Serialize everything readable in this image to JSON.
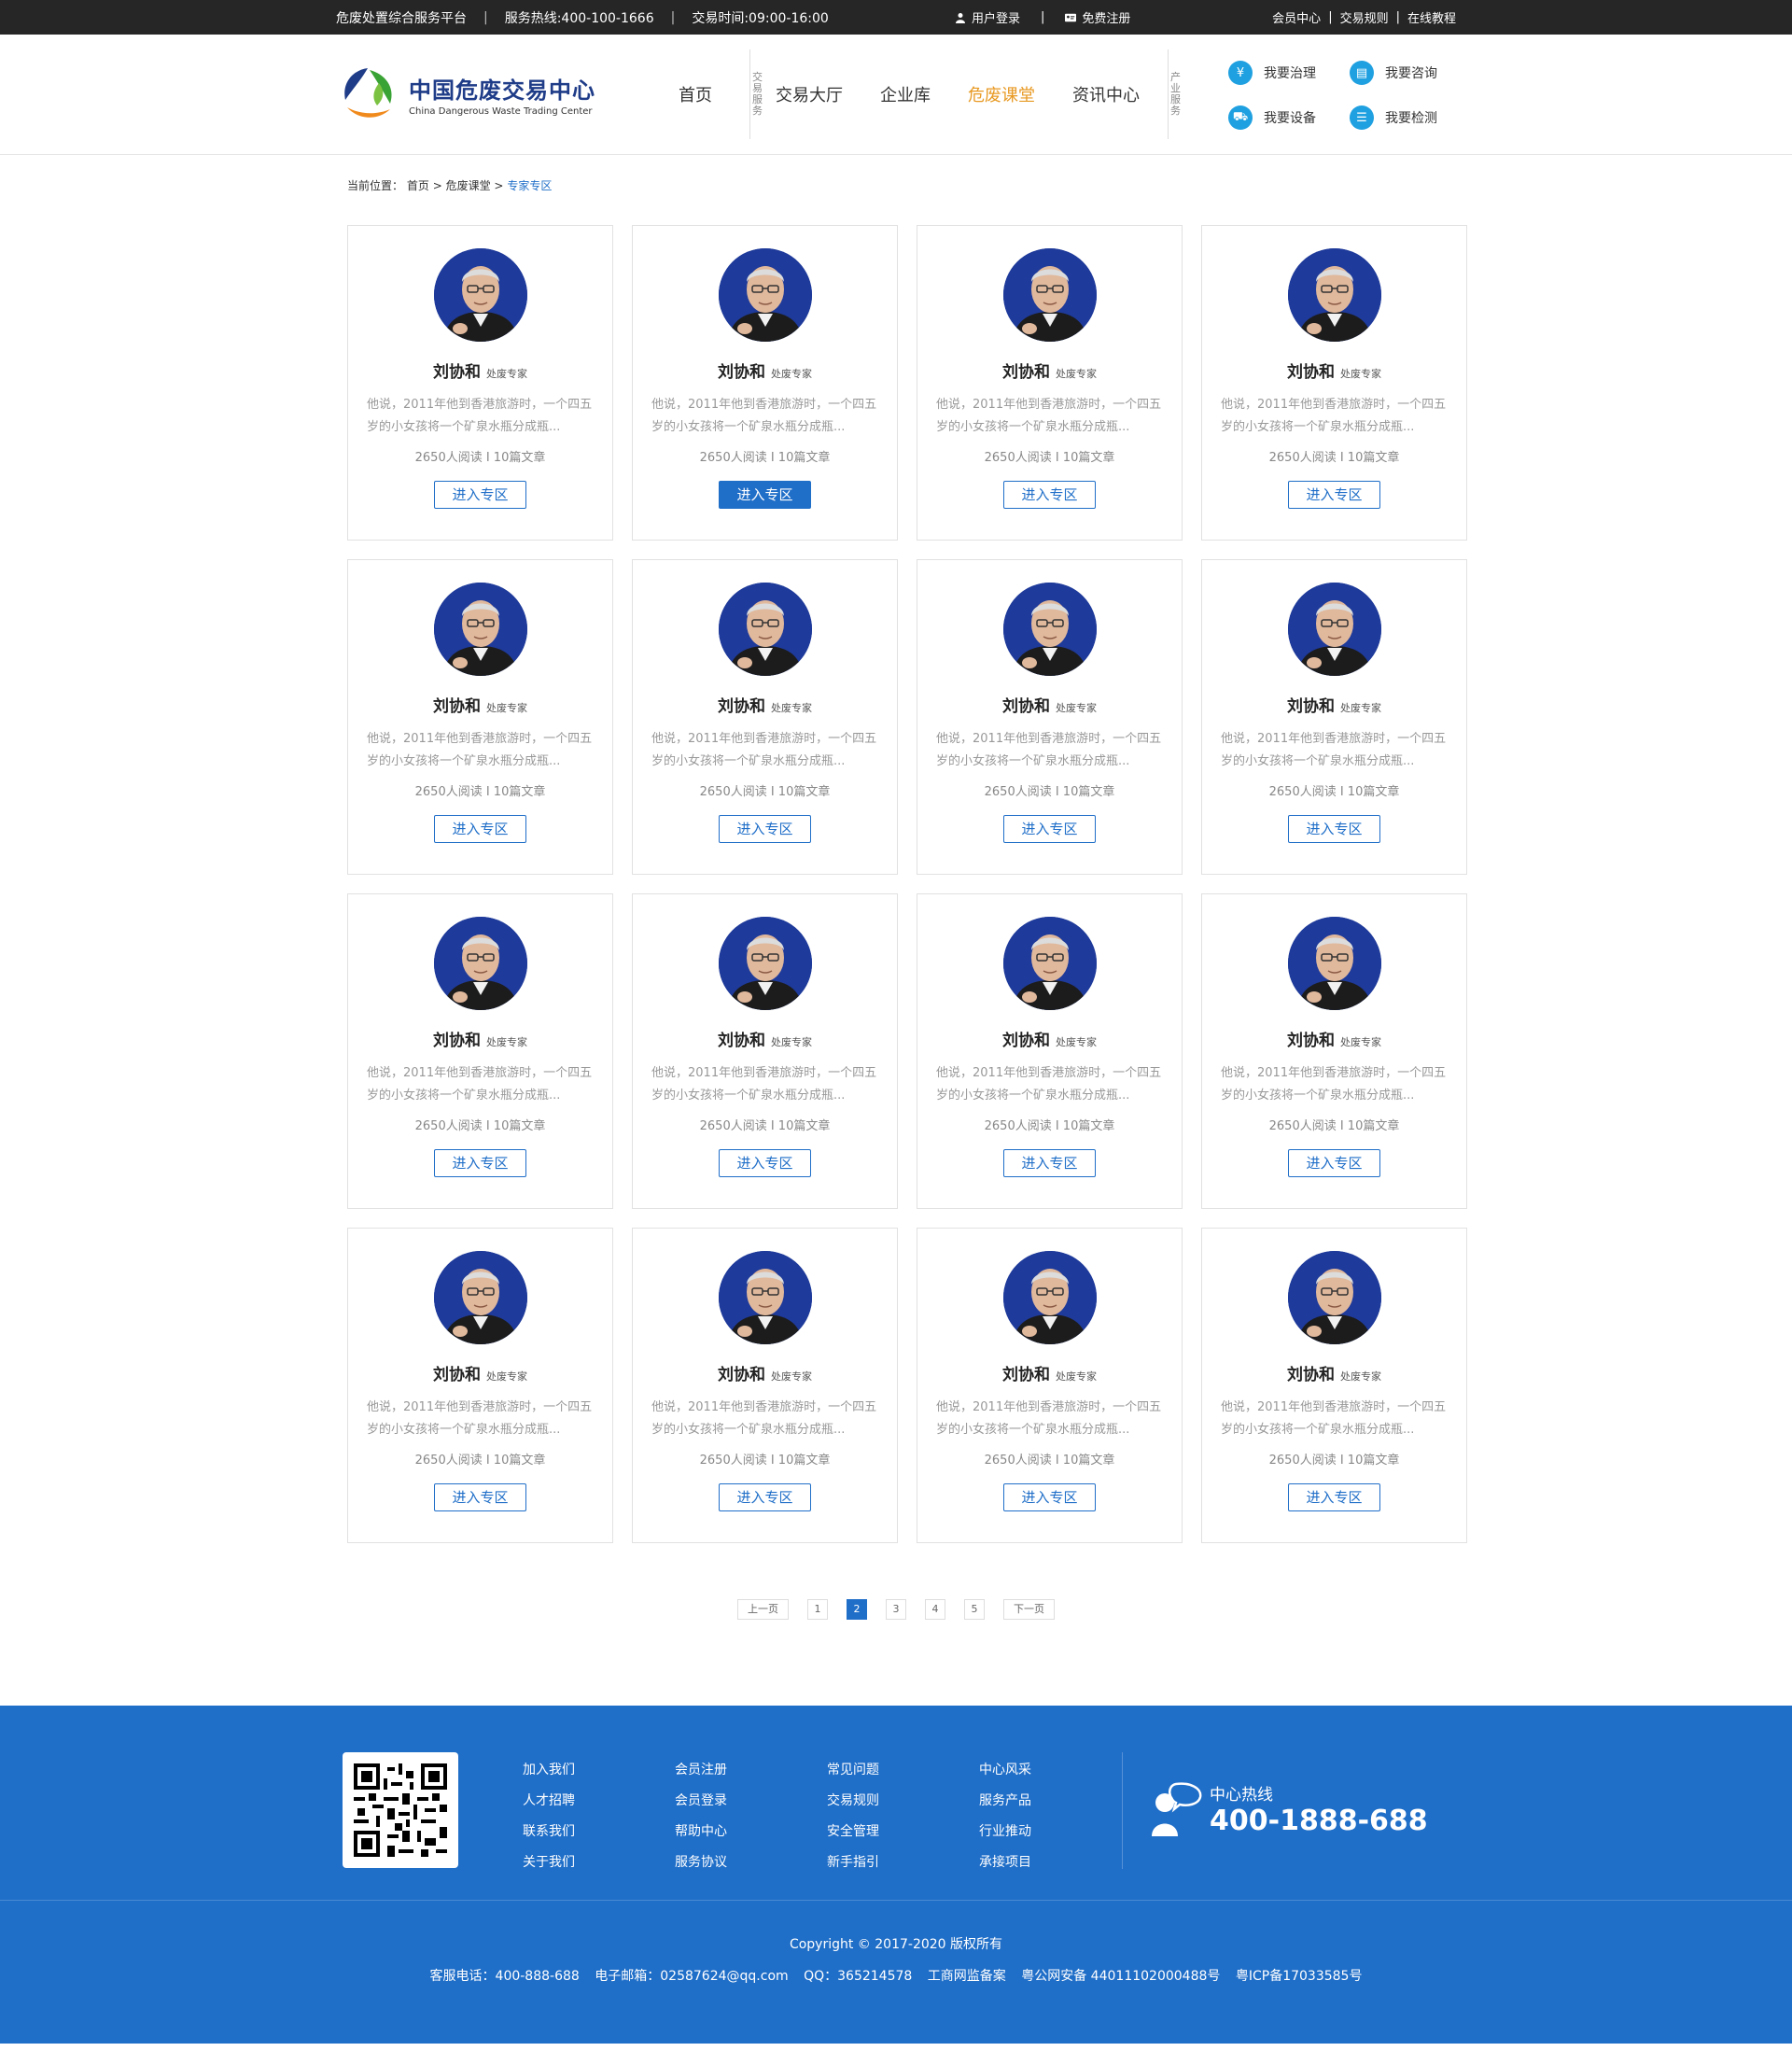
{
  "topbar": {
    "platform": "危废处置综合服务平台",
    "hotline": "服务热线:400-100-1666",
    "hours": "交易时间:09:00-16:00",
    "login": "用户登录",
    "register": "免费注册",
    "member_center": "会员中心",
    "trade_rules": "交易规则",
    "tutorial": "在线教程"
  },
  "logo": {
    "cn": "中国危废交易中心",
    "en": "China Dangerous Waste Trading Center"
  },
  "nav": {
    "items": [
      "首页",
      "交易大厅",
      "企业库",
      "危废课堂",
      "资讯中心"
    ],
    "active_index": 3,
    "vlabel_1": "交易服务",
    "vlabel_2": "产业服务"
  },
  "services": [
    {
      "label": "我要治理",
      "icon": "yen-icon"
    },
    {
      "label": "我要咨询",
      "icon": "chat-icon"
    },
    {
      "label": "我要设备",
      "icon": "truck-icon"
    },
    {
      "label": "我要检测",
      "icon": "list-icon"
    }
  ],
  "breadcrumb": {
    "prefix": "当前位置：",
    "home": "首页",
    "sep": ">",
    "section": "危废课堂",
    "current": "专家专区"
  },
  "expert_card": {
    "name": "刘协和",
    "role": "处废专家",
    "desc": "他说，2011年他到香港旅游时，一个四五岁的小女孩将一个矿泉水瓶分成瓶...",
    "stats": "2650人阅读 I 10篇文章",
    "button": "进入专区"
  },
  "cards_count": 16,
  "highlighted_card_index": 1,
  "pagination": {
    "prev": "上一页",
    "pages": [
      "1",
      "2",
      "3",
      "4",
      "5"
    ],
    "active": "2",
    "next": "下一页"
  },
  "footer": {
    "link_columns": [
      [
        "加入我们",
        "人才招聘",
        "联系我们",
        "关于我们"
      ],
      [
        "会员注册",
        "会员登录",
        "帮助中心",
        "服务协议"
      ],
      [
        "常见问题",
        "交易规则",
        "安全管理",
        "新手指引"
      ],
      [
        "中心风采",
        "服务产品",
        "行业推动",
        "承接项目"
      ]
    ],
    "hotline_label": "中心热线",
    "hotline_number": "400-1888-688",
    "copyright": "Copyright © 2017-2020 版权所有",
    "info": [
      "客服电话：400-888-688",
      "电子邮箱：02587624@qq.com",
      "QQ：365214578",
      "工商网监备案",
      "粤公网安备 44011102000488号",
      "粤ICP备17033585号"
    ]
  },
  "colors": {
    "primary": "#1f6ec8",
    "active_nav": "#e89a24",
    "topbar_bg": "#262626",
    "service_icon": "#1fa0e0"
  }
}
